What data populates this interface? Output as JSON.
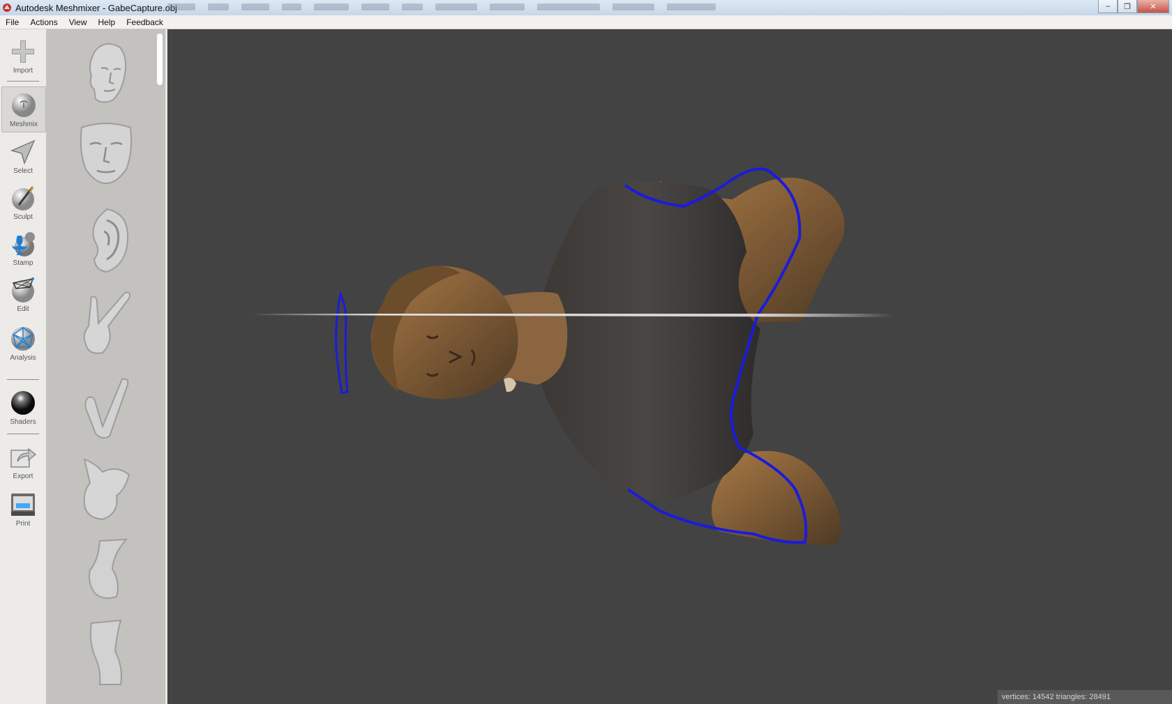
{
  "window": {
    "title": "Autodesk Meshmixer - GabeCapture.obj"
  },
  "menu": [
    "File",
    "Actions",
    "View",
    "Help",
    "Feedback"
  ],
  "tools": [
    {
      "label": "Import",
      "icon": "import-plus-icon"
    },
    {
      "label": "Meshmix",
      "icon": "meshmix-sphere-icon",
      "active": true
    },
    {
      "label": "Select",
      "icon": "select-arrow-icon"
    },
    {
      "label": "Sculpt",
      "icon": "sculpt-brush-icon"
    },
    {
      "label": "Stamp",
      "icon": "stamp-fleur-icon"
    },
    {
      "label": "Edit",
      "icon": "edit-sphere-icon"
    },
    {
      "label": "Analysis",
      "icon": "analysis-mesh-icon"
    },
    {
      "label": "Shaders",
      "icon": "shaders-ball-icon"
    },
    {
      "label": "Export",
      "icon": "export-arrow-icon"
    },
    {
      "label": "Print",
      "icon": "print-printer-icon"
    }
  ],
  "library": [
    "head",
    "face",
    "ear",
    "hand-peace",
    "hand-v",
    "torso",
    "foot",
    "leg"
  ],
  "viewport": {
    "model_name": "GabeCapture.obj",
    "selection_color": "#1b1bdc",
    "plane_color": "#d8d8d8",
    "background": "#434343"
  },
  "status": {
    "text": "vertices: 14542 triangles: 28491"
  }
}
